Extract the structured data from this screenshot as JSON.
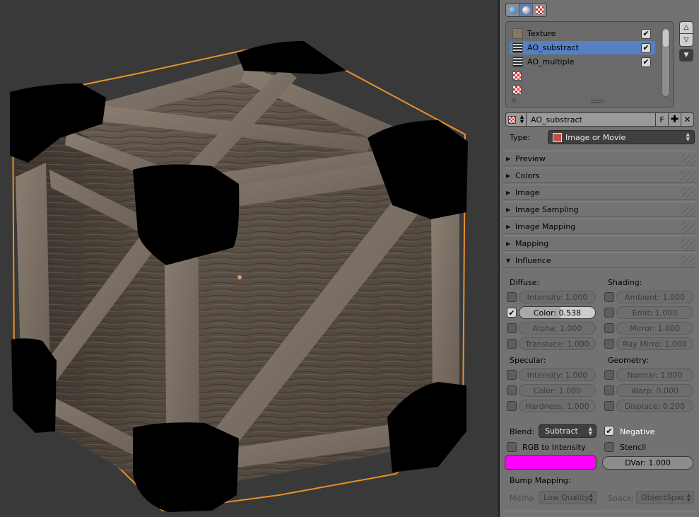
{
  "context_tabs": [
    {
      "name": "world",
      "color": "#4a86c8"
    },
    {
      "name": "material",
      "color": "#c8c8c8"
    },
    {
      "name": "texture",
      "color": "#c33"
    }
  ],
  "texture_slots": [
    {
      "label": "Texture",
      "checked": true
    },
    {
      "label": "AO_substract",
      "checked": true,
      "active": true
    },
    {
      "label": "AO_multiple",
      "checked": true
    },
    {
      "label": ""
    },
    {
      "label": ""
    }
  ],
  "texture_datablock": {
    "name": "AO_substract",
    "fake_user_label": "F"
  },
  "type": {
    "label": "Type:",
    "value": "Image or Movie"
  },
  "sections": [
    {
      "label": "Preview",
      "expanded": false
    },
    {
      "label": "Colors",
      "expanded": false
    },
    {
      "label": "Image",
      "expanded": false
    },
    {
      "label": "Image Sampling",
      "expanded": false
    },
    {
      "label": "Image Mapping",
      "expanded": false
    },
    {
      "label": "Mapping",
      "expanded": false
    },
    {
      "label": "Influence",
      "expanded": true
    }
  ],
  "influence": {
    "diffuse_label": "Diffuse:",
    "shading_label": "Shading:",
    "specular_label": "Specular:",
    "geometry_label": "Geometry:",
    "diffuse": [
      {
        "label": "Intensity: 1.000",
        "enabled": false
      },
      {
        "label": "Color: 0.538",
        "enabled": true,
        "fraction": 0.538
      },
      {
        "label": "Alpha: 1.000",
        "enabled": false
      },
      {
        "label": "Transluce: 1.000",
        "enabled": false
      }
    ],
    "shading": [
      {
        "label": "Ambient: 1.000",
        "enabled": false
      },
      {
        "label": "Emit: 1.000",
        "enabled": false
      },
      {
        "label": "Mirror: 1.000",
        "enabled": false
      },
      {
        "label": "Ray Mirro: 1.000",
        "enabled": false
      }
    ],
    "specular": [
      {
        "label": "Intensity: 1.000",
        "enabled": false
      },
      {
        "label": "Color: 1.000",
        "enabled": false
      },
      {
        "label": "Hardness: 1.000",
        "enabled": false
      }
    ],
    "geometry": [
      {
        "label": "Normal: 1.000",
        "enabled": false
      },
      {
        "label": "Warp: 0.000",
        "enabled": false
      },
      {
        "label": "Displace: 0.200",
        "enabled": false
      }
    ],
    "blend_label": "Blend:",
    "blend_value": "Subtract",
    "negative_label": "Negative",
    "negative_checked": true,
    "rgb_to_intensity_label": "RGB to Intensity",
    "stencil_label": "Stencil",
    "color_swatch": "#ff00ff",
    "dvar_label": "DVar: 1.000",
    "bump_mapping_label": "Bump Mapping:",
    "method_label": "Metho",
    "method_value": "Low Quality",
    "space_label": "Space:",
    "space_value": "ObjectSpac"
  }
}
